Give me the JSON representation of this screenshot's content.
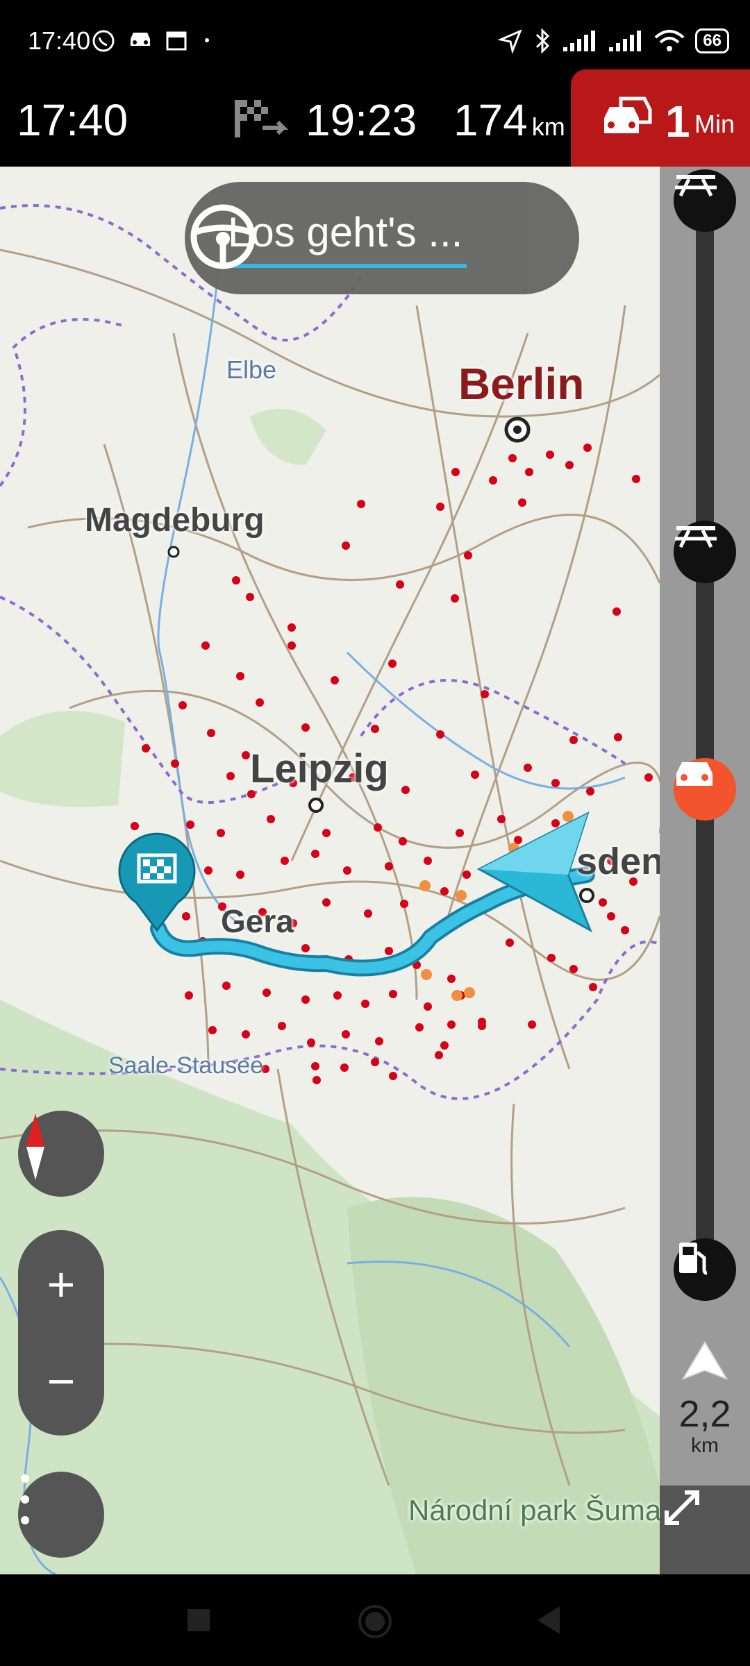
{
  "status_bar": {
    "time": "17:40",
    "battery": "66",
    "icons": [
      "whatsapp-icon",
      "car-icon",
      "calendar-icon",
      "dot-icon",
      "location-arrow-icon",
      "bluetooth-icon",
      "signal-icon",
      "signal-icon",
      "wifi-icon",
      "battery-icon"
    ]
  },
  "trip_info": {
    "current_time": "17:40",
    "arrival_time": "19:23",
    "distance_value": "174",
    "distance_unit": "km",
    "traffic_delay_value": "1",
    "traffic_delay_unit": "Min"
  },
  "map": {
    "drive_prompt": "Los geht's ...",
    "places": {
      "berlin": "Berlin",
      "magdeburg": "Magdeburg",
      "leipzig": "Leipzig",
      "gera": "Gera",
      "dresden_partial": "sden",
      "elbe": "Elbe",
      "saale_stausee": "Saale-Stausee",
      "sumava": "Národní park Šumava"
    },
    "next_event_distance": "2,2",
    "next_event_unit": "km",
    "colors": {
      "route": "#3bc3e6",
      "traffic_red": "#b81818",
      "incident_dot": "#d60017",
      "destination_marker": "#1799b5"
    }
  }
}
